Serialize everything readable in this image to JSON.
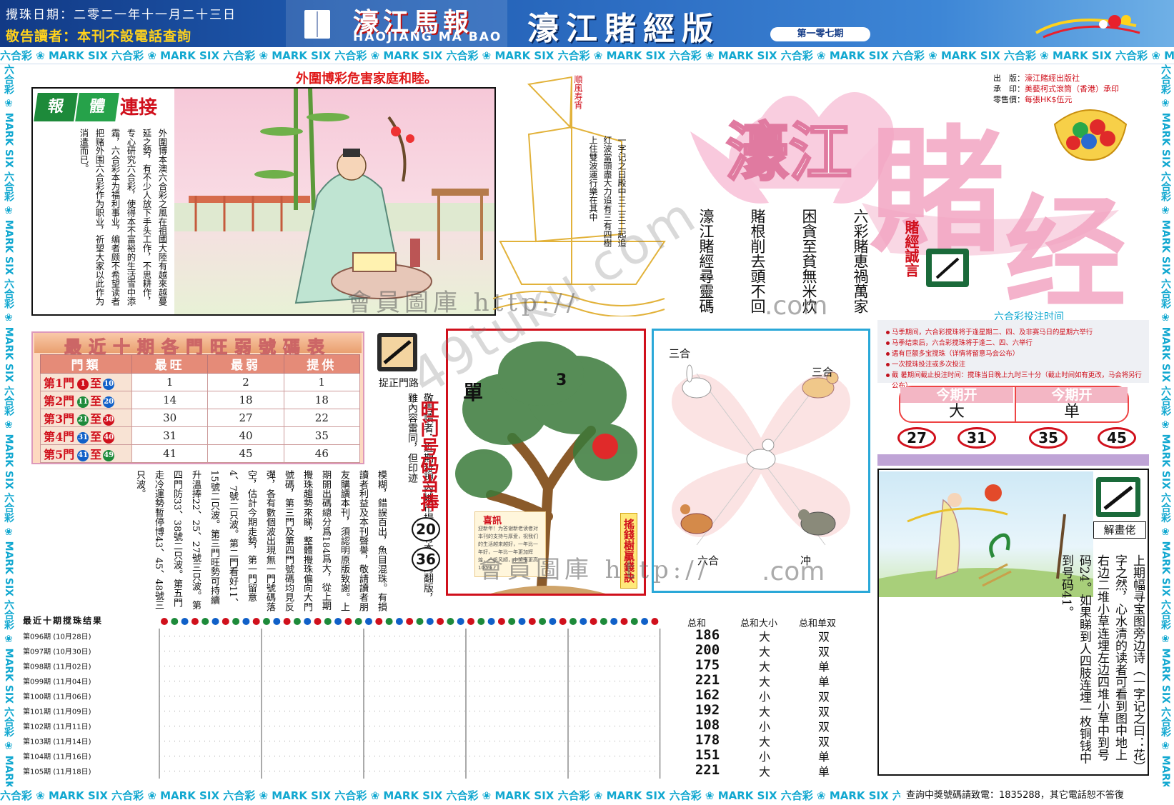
{
  "header": {
    "draw_date": "攪珠日期：二零二一年十一月二十三日",
    "notice": "敬告讀者：本刊不設電話查詢",
    "paper_name": "濠江馬報",
    "paper_name_en": "HAOJIANG MA BAO",
    "edition_title": "濠江賭經版",
    "issue_no": "第一零七期"
  },
  "border_text": "六合彩 ❀ MARK SIX 六合彩 ❀ MARK SIX 六合彩 ❀ MARK SIX 六合彩 ❀ MARK SIX 六合彩 ❀ MARK SIX 六合彩 ❀ MARK SIX 六合彩 ❀ MARK SIX 六合彩 ❀ MARK SIX 六合彩 ❀ MARK SIX 六合彩 ❀ MARK SIX 六合彩 ❀ MARK SIX",
  "slogan": "外圍博彩危害家庭和睦。",
  "article": {
    "tag1": "報",
    "tag2": "體",
    "title_red": "連接",
    "text": "外圍博本澳六合彩之風在祖國大陸有越來越蔓延之勢，有不少人放下手头工作，不思耕作，专心研究六合彩，使得本不富裕的生活雪中添霜，六合彩本为福利事业，编者颇不希望读者把赌外围六合彩作为职业，祈望大家以此作为消遣而已。"
  },
  "boat": {
    "flag": "順風寿宵",
    "text": "一字记之曰殿中三二三二起追红波當頭盡大力追有三有四樹上住雙波運行樂在其中"
  },
  "poem_columns": [
    "六彩賭恵禍萬家",
    "困貪至貧無米炊",
    "賭根削去頭不回",
    "濠江賭經尋靈碼"
  ],
  "big_logo": {
    "line1": "濠江",
    "line2": "賭",
    "line3": "经",
    "sub": "賭經誠言"
  },
  "publisher": {
    "rows": [
      {
        "k": "出　版：",
        "v": "濠江賭經出版社"
      },
      {
        "k": "承　印：",
        "v": "美藝柯式滾筒（香港）承印"
      },
      {
        "k": "零售價：",
        "v": "每張HK$伍元"
      }
    ]
  },
  "bet_time": {
    "title": "六合彩投注时间",
    "items": [
      "马季期间，六合彩搅珠将于逢星期二、四、及非赛马日的星期六举行",
      "马季结束后，六合彩搅珠将于逢二、四、六举行",
      "遇有巨额多宝搅珠（详情将留意马会公布）",
      "一次搅珠投注或多次投注",
      "截 暑期间截止投注时间：搅珠当日晚上九时三十分（截止时间如有更改，马会将另行公布）"
    ]
  },
  "this_period": {
    "head1": "今期开",
    "val1": "大",
    "head2": "今期开",
    "val2": "单",
    "numbers": [
      "27",
      "31",
      "35",
      "45"
    ]
  },
  "strength_table": {
    "title": "最近十期各門旺弱號碼表",
    "headers": [
      "門類",
      "最旺",
      "最弱",
      "提供"
    ],
    "rows": [
      {
        "door": "第1門",
        "from": "1",
        "to": "10",
        "from_color": "#d0101c",
        "to_color": "#1060c8",
        "best": "1",
        "worst": "2",
        "offer": "1"
      },
      {
        "door": "第2門",
        "from": "11",
        "to": "20",
        "from_color": "#1d8a3a",
        "to_color": "#1060c8",
        "best": "14",
        "worst": "18",
        "offer": "18"
      },
      {
        "door": "第3門",
        "from": "21",
        "to": "30",
        "from_color": "#1d8a3a",
        "to_color": "#d0101c",
        "best": "30",
        "worst": "27",
        "offer": "22"
      },
      {
        "door": "第4門",
        "from": "31",
        "to": "40",
        "from_color": "#1060c8",
        "to_color": "#d0101c",
        "best": "31",
        "worst": "40",
        "offer": "35"
      },
      {
        "door": "第5門",
        "from": "41",
        "to": "49",
        "from_color": "#1060c8",
        "to_color": "#1d8a3a",
        "best": "41",
        "worst": "45",
        "offer": "46"
      }
    ],
    "to_word": "至"
  },
  "correct_door": {
    "label": "捉正門路",
    "notice": "敬告讀者：近期發現內地市場上有本刊的翻版，雖內容雷同，但印迹",
    "hot_title": "旺门号码当捧",
    "hot_numbers": [
      "20",
      "36"
    ]
  },
  "commentary": "模糊，錯誤百出，魚目混珠。有損讀者利益及本刊聲譽，敬請讀者朋友購讀本刊，須認明原版致謝。上期開出碼總分爲184爲大，從上期攪珠趨勢來睇，整體攪珠偏向大門號碼，第三門及第四門號碼均見反彈，各有數個波出現無一門號碼落空，估計今期走勢，第一門留意4、7號二只波。第二門看好11、15號二只波。第三門旺勢可持續升溫捧22、25、27號三只波。第四門防33、38號二只波。第五門走冷運勢暫停博43、45、48號三只波。",
  "money_tree": {
    "single": "單",
    "three": "3",
    "side": "搖錢樹贏錢訣",
    "card_title": "喜訊",
    "card_text": "迎新年！为答谢新老读者对本刊的支持与厚爱，祝我们的生活越来越好，一年比一年好，一年比一年更加辉煌，一帆风顺，中奖率更高100%"
  },
  "zodiac": {
    "labels": [
      "三合",
      "三合",
      "六合",
      "冲"
    ]
  },
  "riddle": {
    "label": "解畫佬",
    "text": "上期幅寻宝图旁边诗（一字记之曰：花）字之然，心水清的读者可看到图中地上右边二堆小草连埋左边四堆小草中到号码24。如果睇到人四肢连埋一枚铜钱中到号码41。"
  },
  "results": {
    "title": "最近十期搅珠结果",
    "head_sum": "总和",
    "head_bs": "总和大小",
    "head_oe": "总和单双",
    "draws": [
      {
        "period": "第096期",
        "date": "10月28日",
        "sum": "186",
        "bs": "大",
        "oe": "双"
      },
      {
        "period": "第097期",
        "date": "10月30日",
        "sum": "200",
        "bs": "大",
        "oe": "双"
      },
      {
        "period": "第098期",
        "date": "11月02日",
        "sum": "175",
        "bs": "大",
        "oe": "单"
      },
      {
        "period": "第099期",
        "date": "11月04日",
        "sum": "221",
        "bs": "大",
        "oe": "单"
      },
      {
        "period": "第100期",
        "date": "11月06日",
        "sum": "162",
        "bs": "小",
        "oe": "双"
      },
      {
        "period": "第101期",
        "date": "11月09日",
        "sum": "192",
        "bs": "大",
        "oe": "双"
      },
      {
        "period": "第102期",
        "date": "11月11日",
        "sum": "108",
        "bs": "小",
        "oe": "双"
      },
      {
        "period": "第103期",
        "date": "11月14日",
        "sum": "178",
        "bs": "大",
        "oe": "双"
      },
      {
        "period": "第104期",
        "date": "11月16日",
        "sum": "151",
        "bs": "小",
        "oe": "单"
      },
      {
        "period": "第105期",
        "date": "11月18日",
        "sum": "221",
        "bs": "大",
        "oe": "单"
      }
    ]
  },
  "watermark": {
    "w1": "會員圖庫 http://",
    "w2": "會員圖庫 http://",
    "w3": ".com",
    "w4": ".com",
    "diag": "49tuku.com"
  },
  "footer": {
    "contact": "查詢中獎號碼請致電：1835288，其它電話恕不答復"
  },
  "colors": {
    "brand_blue": "#123a86",
    "accent_red": "#d0101c",
    "border_cyan": "#12a8d0"
  }
}
